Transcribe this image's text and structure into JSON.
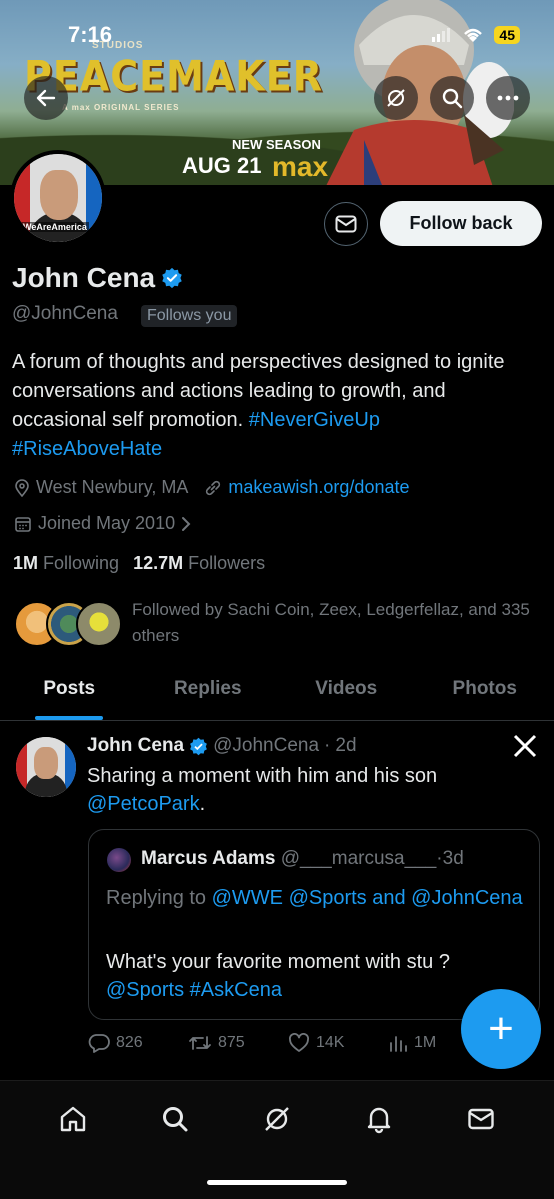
{
  "status_bar": {
    "time": "7:16",
    "battery": "45"
  },
  "banner": {
    "studios": "STUDIOS",
    "show_title": "PEACEMAKER",
    "series_label": "A max ORIGINAL SERIES",
    "new_season": "NEW SEASON",
    "air_date": "AUG 21",
    "network": "max"
  },
  "avatar_tag": "#WeAreAmerica",
  "profile": {
    "name": "John Cena",
    "handle": "@JohnCena",
    "follows_you": "Follows you",
    "follow_button": "Follow back",
    "bio_text": "A forum of thoughts and perspectives designed to ignite conversations and actions leading to growth, and occasional self promotion. ",
    "bio_tag1": "#NeverGiveUp",
    "bio_tag2": "#RiseAboveHate",
    "location": "West Newbury, MA",
    "website": "makeawish.org/donate",
    "joined": "Joined May 2010",
    "following_count": "1M",
    "following_label": "Following",
    "followers_count": "12.7M",
    "followers_label": "Followers",
    "followed_by": "Followed by Sachi Coin, Zeex, Ledgerfellaz, and 335 others"
  },
  "tabs": [
    {
      "label": "Posts",
      "active": true
    },
    {
      "label": "Replies",
      "active": false
    },
    {
      "label": "Videos",
      "active": false
    },
    {
      "label": "Photos",
      "active": false
    }
  ],
  "post": {
    "author": "John Cena",
    "handle": "@JohnCena",
    "time": "2d",
    "text": "Sharing a moment with him and his son ",
    "mention": "@PetcoPark",
    "text_end": ".",
    "quote": {
      "author": "Marcus Adams",
      "handle": "@___marcusa___",
      "time": "3d",
      "replying_to": "Replying to",
      "reply_mentions": "@WWE @Sports and @JohnCena",
      "text": "What's your favorite moment with stu ?",
      "text_links": "@Sports #AskCena"
    },
    "stats": {
      "replies": "826",
      "reposts": "875",
      "likes": "14K",
      "views": "1M"
    }
  },
  "fab_label": "+",
  "colors": {
    "accent": "#1d9bf0",
    "background": "#000000",
    "secondary_text": "#71767b"
  }
}
